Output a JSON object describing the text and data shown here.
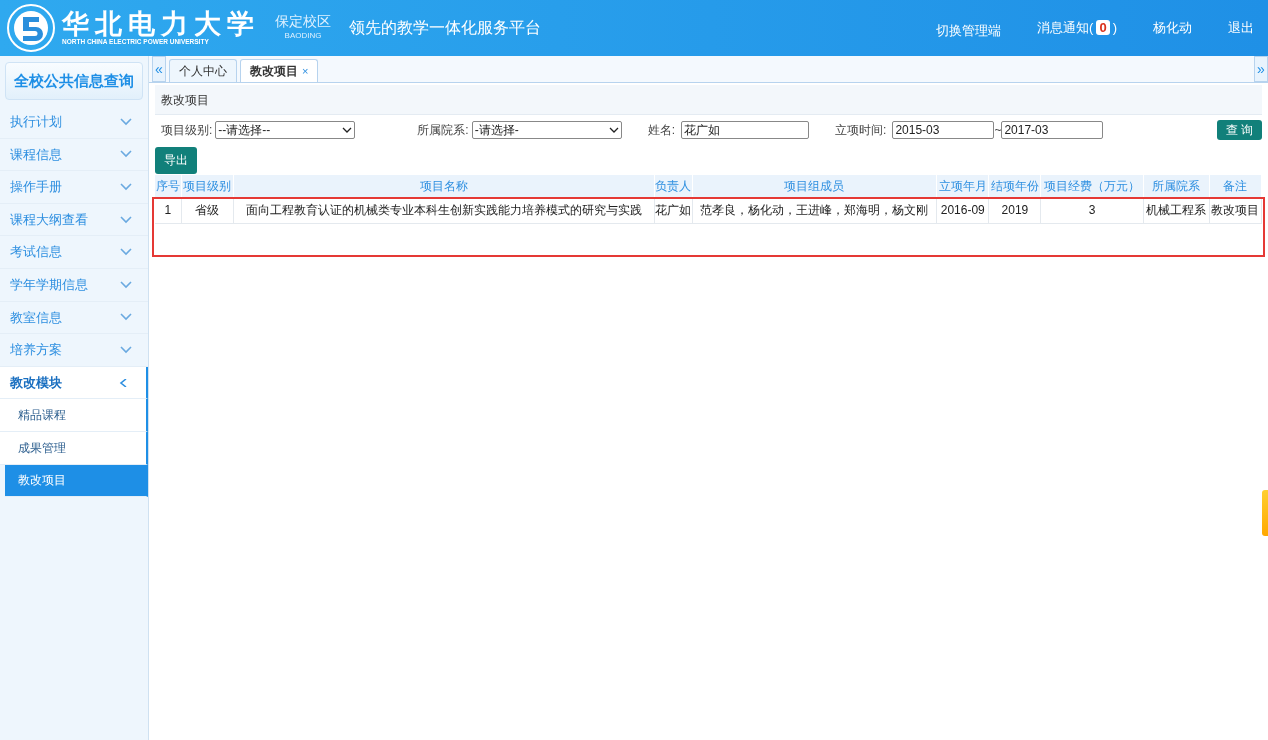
{
  "header": {
    "logo_cn": "华北电力大学",
    "logo_en": "NORTH CHINA ELECTRIC POWER UNIVERSITY",
    "campus": "保定校区",
    "campus_en": "BAODING",
    "platform": "领先的教学一体化服务平台",
    "links": [
      {
        "kind": "plain",
        "label": "切换管理端"
      },
      {
        "kind": "notice",
        "label": "消息通知(",
        "count": "0",
        "suffix": ")"
      },
      {
        "kind": "plain",
        "label": "杨化动"
      },
      {
        "kind": "plain",
        "label": "退出"
      }
    ]
  },
  "sidebar": {
    "title": "全校公共信息查询",
    "items": [
      {
        "label": "执行计划",
        "expanded": false
      },
      {
        "label": "课程信息",
        "expanded": false
      },
      {
        "label": "操作手册",
        "expanded": false
      },
      {
        "label": "课程大纲查看",
        "expanded": false
      },
      {
        "label": "考试信息",
        "expanded": false
      },
      {
        "label": "学年学期信息",
        "expanded": false
      },
      {
        "label": "教室信息",
        "expanded": false
      },
      {
        "label": "培养方案",
        "expanded": false
      },
      {
        "label": "教改模块",
        "expanded": true,
        "children": [
          {
            "label": "精品课程",
            "selected": false
          },
          {
            "label": "成果管理",
            "selected": false
          },
          {
            "label": "教改项目",
            "selected": true
          }
        ]
      }
    ]
  },
  "tabs": {
    "collapse": "«",
    "expand": "»",
    "items": [
      {
        "label": "个人中心",
        "selected": false
      },
      {
        "label": "教改项目",
        "selected": true,
        "close": "×"
      }
    ]
  },
  "page_title": "教改项目",
  "filters": {
    "level_label": "项目级别:",
    "level_value": "--请选择--",
    "dept_label": "所属院系:",
    "dept_value": "-请选择-",
    "name_label": "姓名:",
    "name_value": "花广如",
    "time_label": "立项时间:",
    "time_from": "2015-03",
    "time_sep": "~",
    "time_to": "2017-03",
    "search": "查 询"
  },
  "export": "导出",
  "table": {
    "columns": [
      "序号",
      "项目级别",
      "项目名称",
      "负责人",
      "项目组成员",
      "立项年月",
      "结项年份",
      "项目经费（万元）",
      "所属院系",
      "备注"
    ],
    "rows": [
      [
        "1",
        "省级",
        "面向工程教育认证的机械类专业本科生创新实践能力培养模式的研究与实践",
        "花广如",
        "范孝良，杨化动，王进峰，郑海明，杨文刚",
        "2016-09",
        "2019",
        "3",
        "机械工程系",
        "教改项目"
      ]
    ]
  },
  "highlight": {
    "color": "#e53935"
  }
}
